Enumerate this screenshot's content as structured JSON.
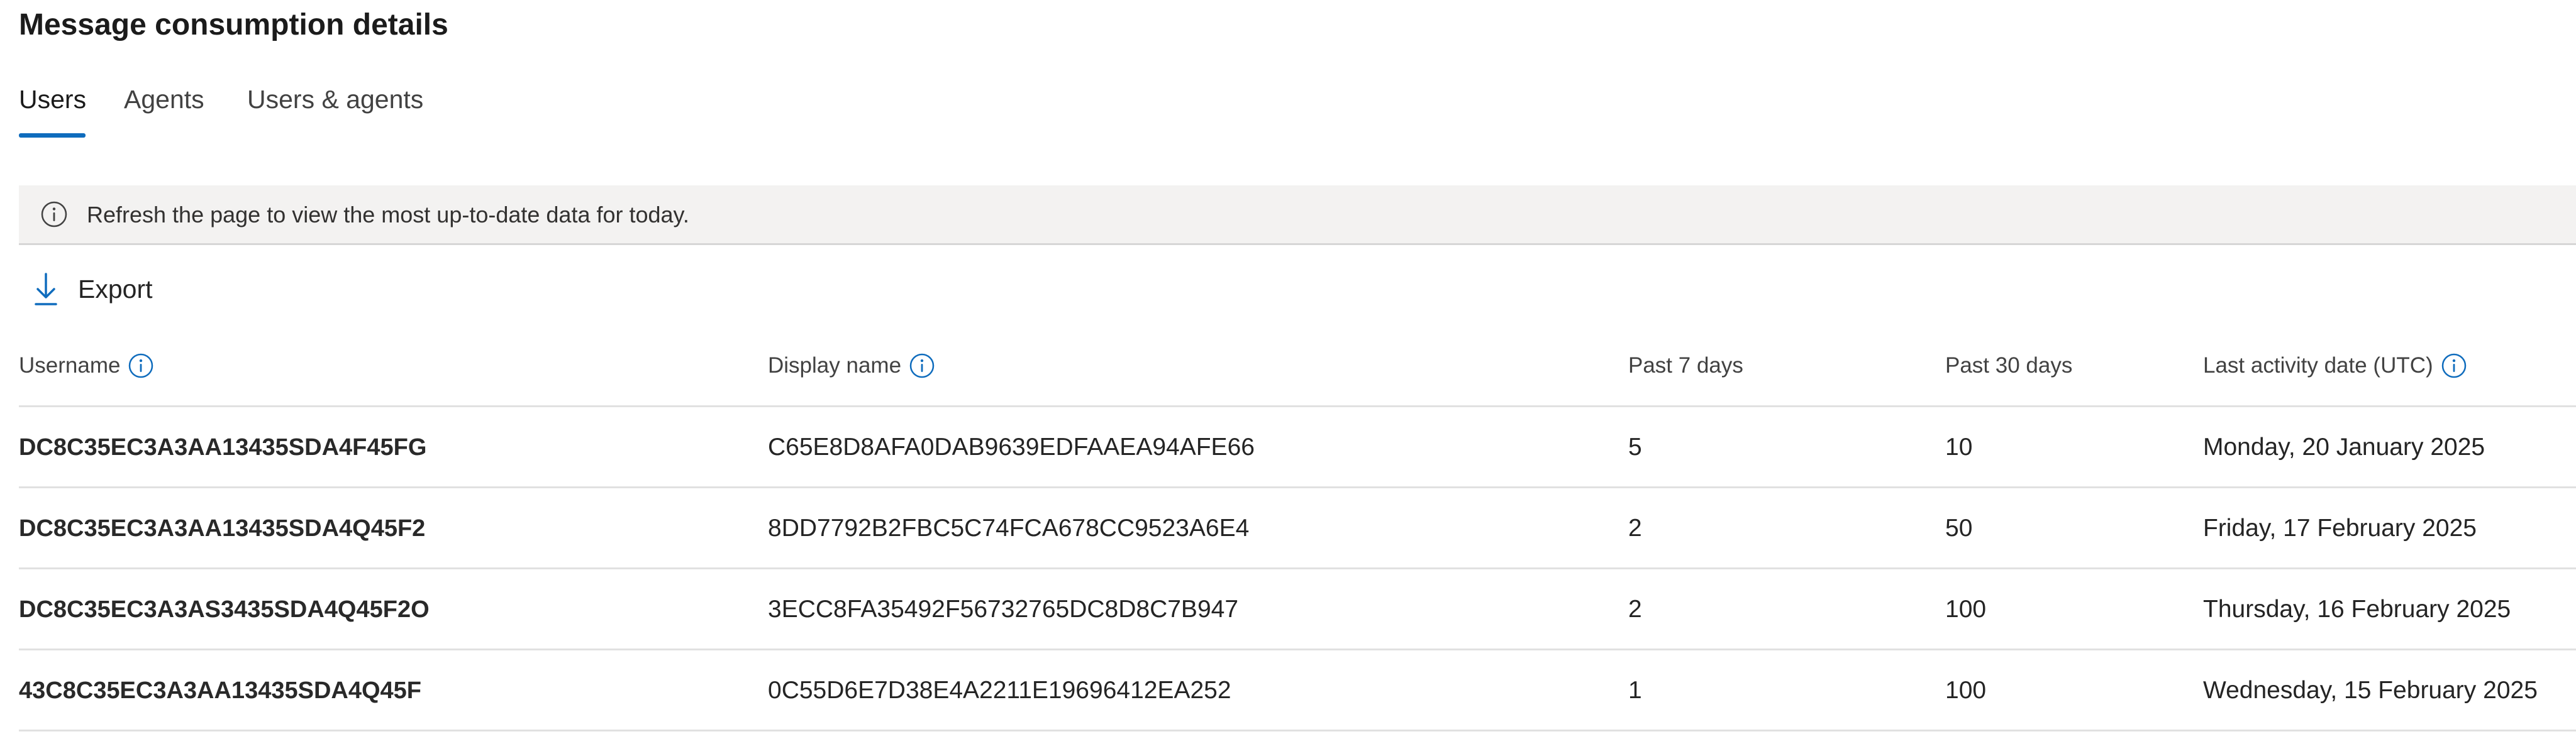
{
  "page": {
    "title": "Message consumption details"
  },
  "tabs": [
    {
      "label": "Users",
      "active": true
    },
    {
      "label": "Agents",
      "active": false
    },
    {
      "label": "Users & agents",
      "active": false
    }
  ],
  "banner": {
    "icon": "info-icon",
    "text": "Refresh the page to view the most up-to-date data for today."
  },
  "toolbar": {
    "export_label": "Export",
    "export_icon": "download-icon"
  },
  "table": {
    "columns": [
      {
        "label": "Username",
        "has_info": true
      },
      {
        "label": "Display name",
        "has_info": true
      },
      {
        "label": "Past 7 days",
        "has_info": false
      },
      {
        "label": "Past 30 days",
        "has_info": false
      },
      {
        "label": "Last activity date (UTC)",
        "has_info": true
      }
    ],
    "rows": [
      {
        "username": "DC8C35EC3A3AA13435SDA4F45FG",
        "display_name": "C65E8D8AFA0DAB9639EDFAAEA94AFE66",
        "past_7_days": "5",
        "past_30_days": "10",
        "last_activity": "Monday, 20 January 2025"
      },
      {
        "username": "DC8C35EC3A3AA13435SDA4Q45F2",
        "display_name": "8DD7792B2FBC5C74FCA678CC9523A6E4",
        "past_7_days": "2",
        "past_30_days": "50",
        "last_activity": "Friday, 17 February 2025"
      },
      {
        "username": "DC8C35EC3A3AS3435SDA4Q45F2O",
        "display_name": "3ECC8FA35492F56732765DC8D8C7B947",
        "past_7_days": "2",
        "past_30_days": "100",
        "last_activity": "Thursday, 16 February 2025"
      },
      {
        "username": "43C8C35EC3A3AA13435SDA4Q45F",
        "display_name": "0C55D6E7D38E4A2211E19696412EA252",
        "past_7_days": "1",
        "past_30_days": "100",
        "last_activity": "Wednesday, 15 February 2025"
      }
    ]
  },
  "colors": {
    "accent": "#0f6cbd",
    "banner_bg": "#f3f2f1",
    "divider": "#e1e1e1"
  }
}
